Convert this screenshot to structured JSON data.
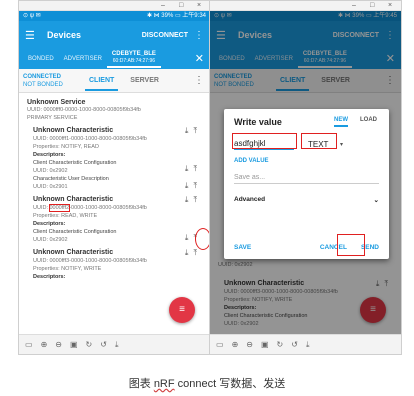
{
  "status_left": {
    "carrier": "⊙ ψ ✉",
    "right": "✱ ⋈ 39% ▭ 上午9:34"
  },
  "status_right": {
    "carrier": "⊙ ψ ✉",
    "right": "✱ ⋈ 39% ▭ 上午9:45"
  },
  "window_controls": {
    "min": "–",
    "max": "□",
    "close": "×"
  },
  "appbar": {
    "menu_icon": "☰",
    "title": "Devices",
    "disconnect": "DISCONNECT",
    "more_icon": "⋮"
  },
  "device_tabs": {
    "bonded": "BONDED",
    "advertiser": "ADVERTISER",
    "device_name": "CDEBYTE_BLE",
    "device_addr": "60:D7:AB:74:27:96",
    "close_icon": "✕"
  },
  "conn_tabs": {
    "connected": "CONNECTED",
    "not_bonded": "NOT BONDED",
    "client": "CLIENT",
    "server": "SERVER"
  },
  "left_screen": {
    "service_name": "Unknown Service",
    "service_uuid": "UUID: 0000fff0-0000-1000-8000-00805f9b34fb",
    "service_type": "PRIMARY SERVICE",
    "chars": [
      {
        "name": "Unknown Characteristic",
        "uuid": "UUID: 0000fff1-0000-1000-8000-00805f9b34fb",
        "props": "Properties: NOTIFY, READ",
        "desc_header": "Descriptors:",
        "descs": [
          {
            "name": "Client Characteristic Configuration",
            "uuid": "UUID: 0x2902"
          },
          {
            "name": "Characteristic User Description",
            "uuid": "UUID: 0x2901"
          }
        ]
      },
      {
        "name": "Unknown Characteristic",
        "uuid_prefix": "UUID: ",
        "uuid_hl": "0000fff2",
        "uuid_rest": "-0000-1000-8000-00805f9b34fb",
        "props": "Properties: READ, WRITE",
        "desc_header": "Descriptors:",
        "descs": [
          {
            "name": "Client Characteristic Configuration",
            "uuid": "UUID: 0x2902"
          }
        ]
      },
      {
        "name": "Unknown Characteristic",
        "uuid": "UUID: 0000fff3-0000-1000-8000-00805f9b34fb",
        "props": "Properties: NOTIFY, WRITE",
        "desc_header": "Descriptors:"
      }
    ]
  },
  "right_screen": {
    "bg_uuid": "UUID: 0x2902",
    "char_name": "Unknown Characteristic",
    "char_uuid": "UUID: 0000fff3-0000-1000-8000-00805f9b34fb",
    "char_props": "Properties: NOTIFY, WRITE",
    "desc_header": "Descriptors:",
    "desc_name": "Client Characteristic Configuration",
    "desc_uuid": "UUID: 0x2902"
  },
  "dialog": {
    "title": "Write value",
    "tab_new": "NEW",
    "tab_load": "LOAD",
    "value": "asdfghjkl",
    "type": "TEXT",
    "type_arrow": "▾",
    "add_value": "ADD VALUE",
    "save_as_placeholder": "Save as...",
    "advanced": "Advanced",
    "advanced_arrow": "⌄",
    "save": "SAVE",
    "cancel": "CANCEL",
    "send": "SEND"
  },
  "icons": {
    "char_actions": "⤓⤒",
    "desc_actions": "⤓⤒",
    "fab": "≡"
  },
  "bottom_toolbar": {
    "glyphs": [
      "▭",
      "⊕",
      "⊖",
      "▣",
      "↻",
      "↺",
      "⤓"
    ]
  },
  "caption": {
    "prefix": "图表 ",
    "app": "nRF",
    "rest": " connect 写数据、发送"
  },
  "colors": {
    "accent": "#1a9be0",
    "fab": "#e23645",
    "highlight_box": "#e02020"
  }
}
